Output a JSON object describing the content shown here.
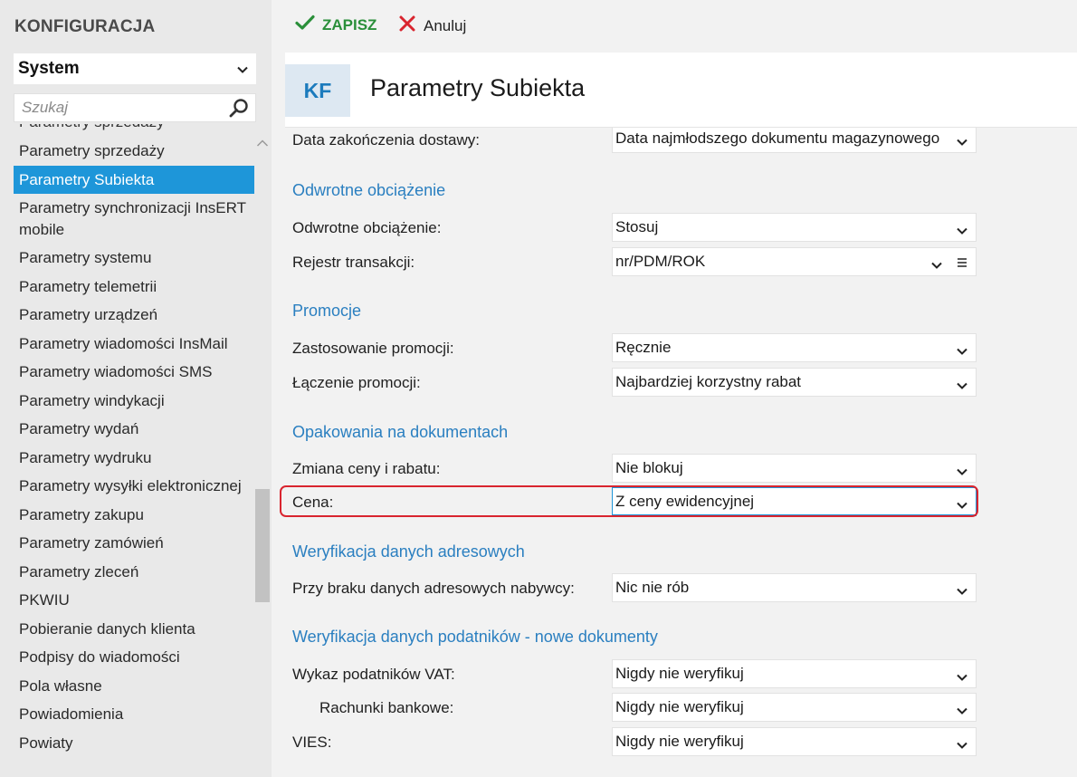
{
  "sidebar": {
    "title": "KONFIGURACJA",
    "module_select": "System",
    "search_placeholder": "Szukaj",
    "clipped_item": "Parametry sprzedaży",
    "items": [
      "Parametry sprzedaży",
      "Parametry Subiekta",
      "Parametry synchronizacji InsERT mobile",
      "Parametry systemu",
      "Parametry telemetrii",
      "Parametry urządzeń",
      "Parametry wiadomości InsMail",
      "Parametry wiadomości SMS",
      "Parametry windykacji",
      "Parametry wydań",
      "Parametry wydruku",
      "Parametry wysyłki elektronicznej",
      "Parametry zakupu",
      "Parametry zamówień",
      "Parametry zleceń",
      "PKWIU",
      "Pobieranie danych klienta",
      "Podpisy do wiadomości",
      "Pola własne",
      "Powiadomienia",
      "Powiaty"
    ],
    "active_index": 1
  },
  "toolbar": {
    "save_label": "ZAPISZ",
    "cancel_label": "Anuluj"
  },
  "header": {
    "badge": "KF",
    "title": "Parametry Subiekta"
  },
  "content": {
    "top_row": {
      "label": "Data zakończenia dostawy:",
      "value": "Data najmłodszego dokumentu magazynowego"
    },
    "sections": {
      "odwrotne": {
        "title": "Odwrotne obciążenie",
        "rows": [
          {
            "label": "Odwrotne obciążenie:",
            "value": "Stosuj"
          },
          {
            "label": "Rejestr transakcji:",
            "value": "nr/PDM/ROK"
          }
        ]
      },
      "promocje": {
        "title": "Promocje",
        "rows": [
          {
            "label": "Zastosowanie promocji:",
            "value": "Ręcznie"
          },
          {
            "label": "Łączenie promocji:",
            "value": "Najbardziej korzystny rabat"
          }
        ]
      },
      "opakowania": {
        "title": "Opakowania na dokumentach",
        "rows": [
          {
            "label": "Zmiana ceny i rabatu:",
            "value": "Nie blokuj"
          },
          {
            "label": "Cena:",
            "value": "Z ceny ewidencyjnej"
          }
        ]
      },
      "adresowe": {
        "title": "Weryfikacja danych adresowych",
        "rows": [
          {
            "label": "Przy braku danych adresowych nabywcy:",
            "value": "Nic nie rób"
          }
        ]
      },
      "podatnikow": {
        "title": "Weryfikacja danych podatników - nowe dokumenty",
        "rows": [
          {
            "label": "Wykaz podatników VAT:",
            "value": "Nigdy nie weryfikuj"
          },
          {
            "label": "Rachunki bankowe:",
            "value": "Nigdy nie weryfikuj"
          },
          {
            "label": "VIES:",
            "value": "Nigdy nie weryfikuj"
          }
        ]
      }
    }
  },
  "colors": {
    "accent": "#1e96d9",
    "section_title": "#2a7fc0",
    "save_green": "#2a8f3a",
    "cancel_red": "#d9252f",
    "highlight_red": "#d9252f"
  }
}
